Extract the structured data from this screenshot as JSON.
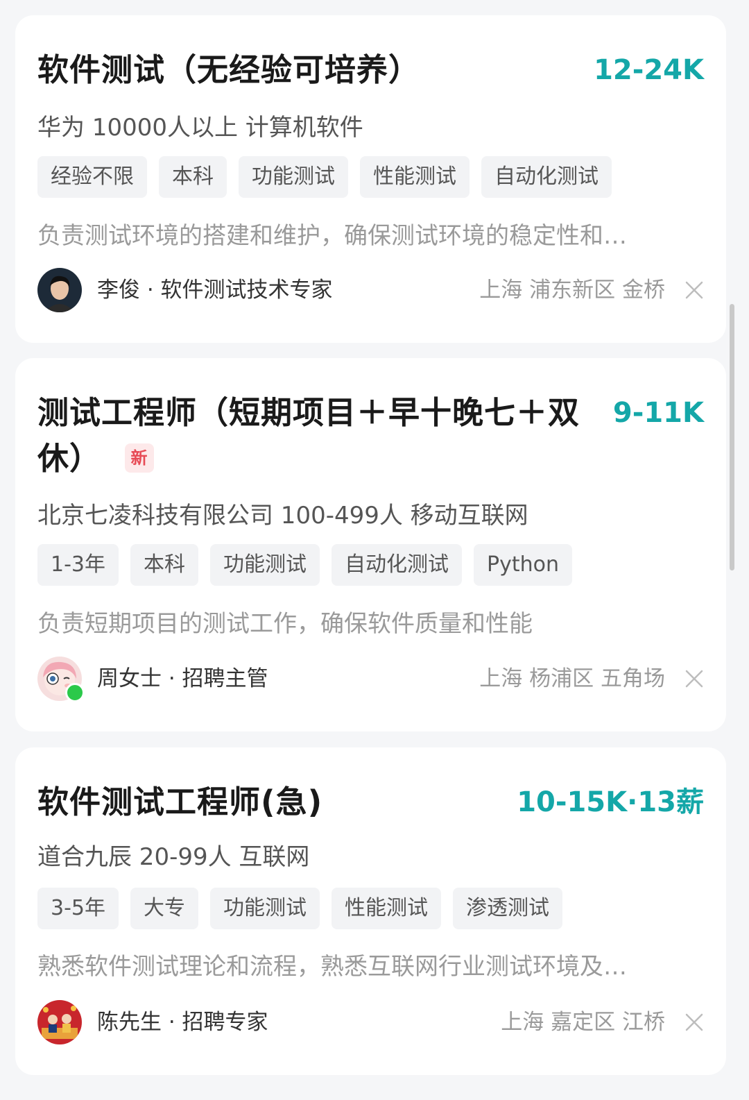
{
  "colors": {
    "salary": "#14a7a8",
    "new_badge": "#e74a55",
    "online": "#2bc94a",
    "background": "#f5f6f8"
  },
  "jobs": [
    {
      "title": "软件测试（无经验可培养）",
      "salary": "12-24K",
      "company": "华为 10000人以上 计算机软件",
      "tags": [
        "经验不限",
        "本科",
        "功能测试",
        "性能测试",
        "自动化测试"
      ],
      "description": "负责测试环境的搭建和维护，确保测试环境的稳定性和…",
      "recruiter": "李俊 · 软件测试技术专家",
      "location": "上海 浦东新区 金桥"
    },
    {
      "title_line1": "测试工程师（短期项目＋早十晚七＋双",
      "title_line2": "休）",
      "badge": "新",
      "salary": "9-11K",
      "company": "北京七凌科技有限公司 100-499人 移动互联网",
      "tags": [
        "1-3年",
        "本科",
        "功能测试",
        "自动化测试",
        "Python"
      ],
      "description": "负责短期项目的测试工作，确保软件质量和性能",
      "recruiter": "周女士 · 招聘主管",
      "location": "上海 杨浦区 五角场"
    },
    {
      "title": "软件测试工程师(急)",
      "salary": "10-15K·13薪",
      "company": "道合九辰 20-99人 互联网",
      "tags": [
        "3-5年",
        "大专",
        "功能测试",
        "性能测试",
        "渗透测试"
      ],
      "description": "熟悉软件测试理论和流程，熟悉互联网行业测试环境及…",
      "recruiter": "陈先生 · 招聘专家",
      "location": "上海 嘉定区 江桥"
    }
  ]
}
